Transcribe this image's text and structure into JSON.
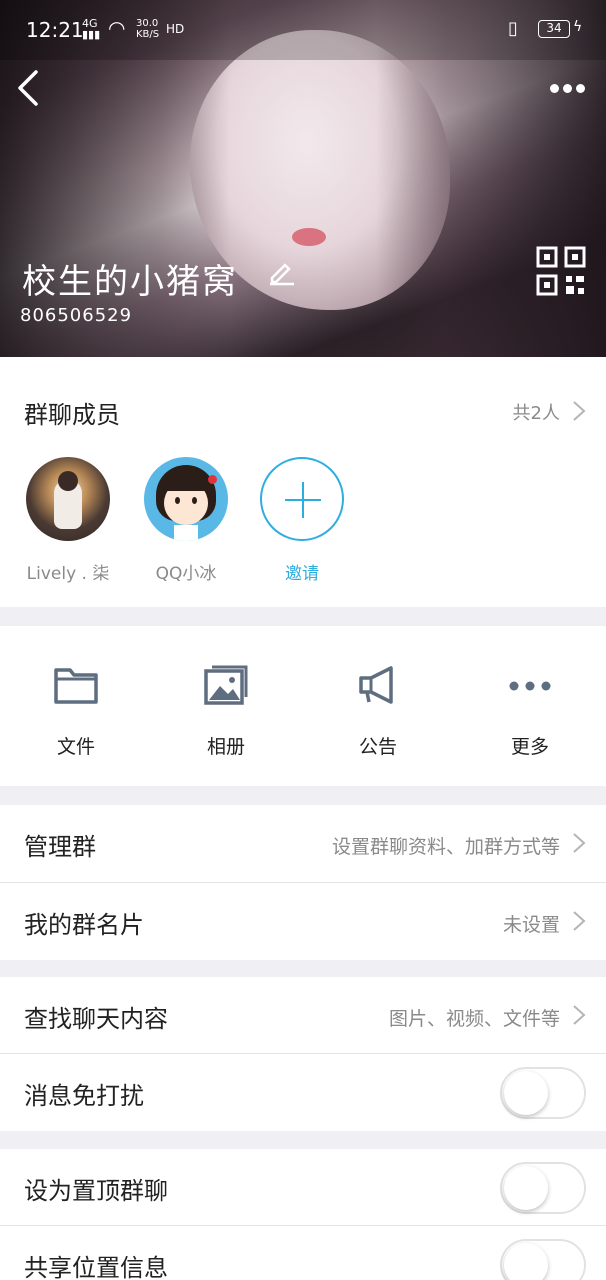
{
  "status": {
    "time": "12:21",
    "network": "4G",
    "speed": "30.0",
    "speed_unit": "KB/S",
    "hd": "HD",
    "battery": "34"
  },
  "header": {
    "group_name": "校生的小猪窝",
    "group_id": "806506529"
  },
  "members": {
    "title": "群聊成员",
    "count": "共2人",
    "list": [
      {
        "name": "Lively . 柒"
      },
      {
        "name": "QQ小冰"
      }
    ],
    "invite_label": "邀请"
  },
  "tools": [
    {
      "label": "文件"
    },
    {
      "label": "相册"
    },
    {
      "label": "公告"
    },
    {
      "label": "更多"
    }
  ],
  "settings": {
    "manage": {
      "label": "管理群",
      "value": "设置群聊资料、加群方式等"
    },
    "card": {
      "label": "我的群名片",
      "value": "未设置"
    },
    "search": {
      "label": "查找聊天内容",
      "value": "图片、视频、文件等"
    },
    "dnd": {
      "label": "消息免打扰",
      "on": false
    },
    "pin": {
      "label": "设为置顶群聊",
      "on": false
    },
    "location": {
      "label": "共享位置信息",
      "on": false
    }
  },
  "colors": {
    "accent": "#2eaee0",
    "background": "#efeff4"
  }
}
